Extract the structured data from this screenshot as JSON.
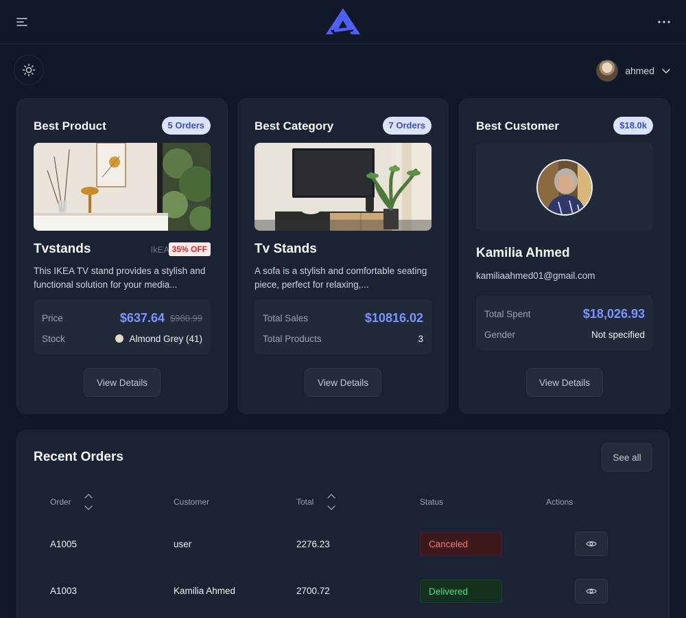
{
  "header": {
    "user_name": "ahmed"
  },
  "best_product": {
    "title": "Best Product",
    "badge": "5 Orders",
    "name": "Tvstands",
    "brand": "IkEA",
    "discount": "35% OFF",
    "description": "This IKEA TV stand provides a stylish and functional solution for your media...",
    "price_label": "Price",
    "price": "$637.64",
    "old_price": "$980.99",
    "stock_label": "Stock",
    "stock_value": "Almond Grey (41)",
    "stock_color": "#e8d9c0",
    "button": "View Details"
  },
  "best_category": {
    "title": "Best Category",
    "badge": "7 Orders",
    "name": "Tv Stands",
    "description": "A sofa is a stylish and comfortable seating piece, perfect for relaxing,...",
    "sales_label": "Total Sales",
    "sales_value": "$10816.02",
    "products_label": "Total Products",
    "products_value": "3",
    "button": "View Details"
  },
  "best_customer": {
    "title": "Best Customer",
    "badge": "$18.0k",
    "name": "Kamilia Ahmed",
    "email": "kamiliaahmed01@gmail.com",
    "spent_label": "Total Spent",
    "spent_value": "$18,026.93",
    "gender_label": "Gender",
    "gender_value": "Not specified",
    "button": "View Details"
  },
  "recent_orders": {
    "title": "Recent Orders",
    "see_all": "See all",
    "columns": [
      "Order",
      "Customer",
      "Total",
      "Status",
      "Actions"
    ],
    "rows": [
      {
        "order": "A1005",
        "customer": "user",
        "total": "2276.23",
        "status": "Canceled"
      },
      {
        "order": "A1003",
        "customer": "Kamilia Ahmed",
        "total": "2700.72",
        "status": "Delivered"
      }
    ]
  },
  "colors": {
    "accent": "#4f5ff5",
    "price": "#7b95ff",
    "canceled": "#f87171",
    "delivered": "#4ade80"
  }
}
